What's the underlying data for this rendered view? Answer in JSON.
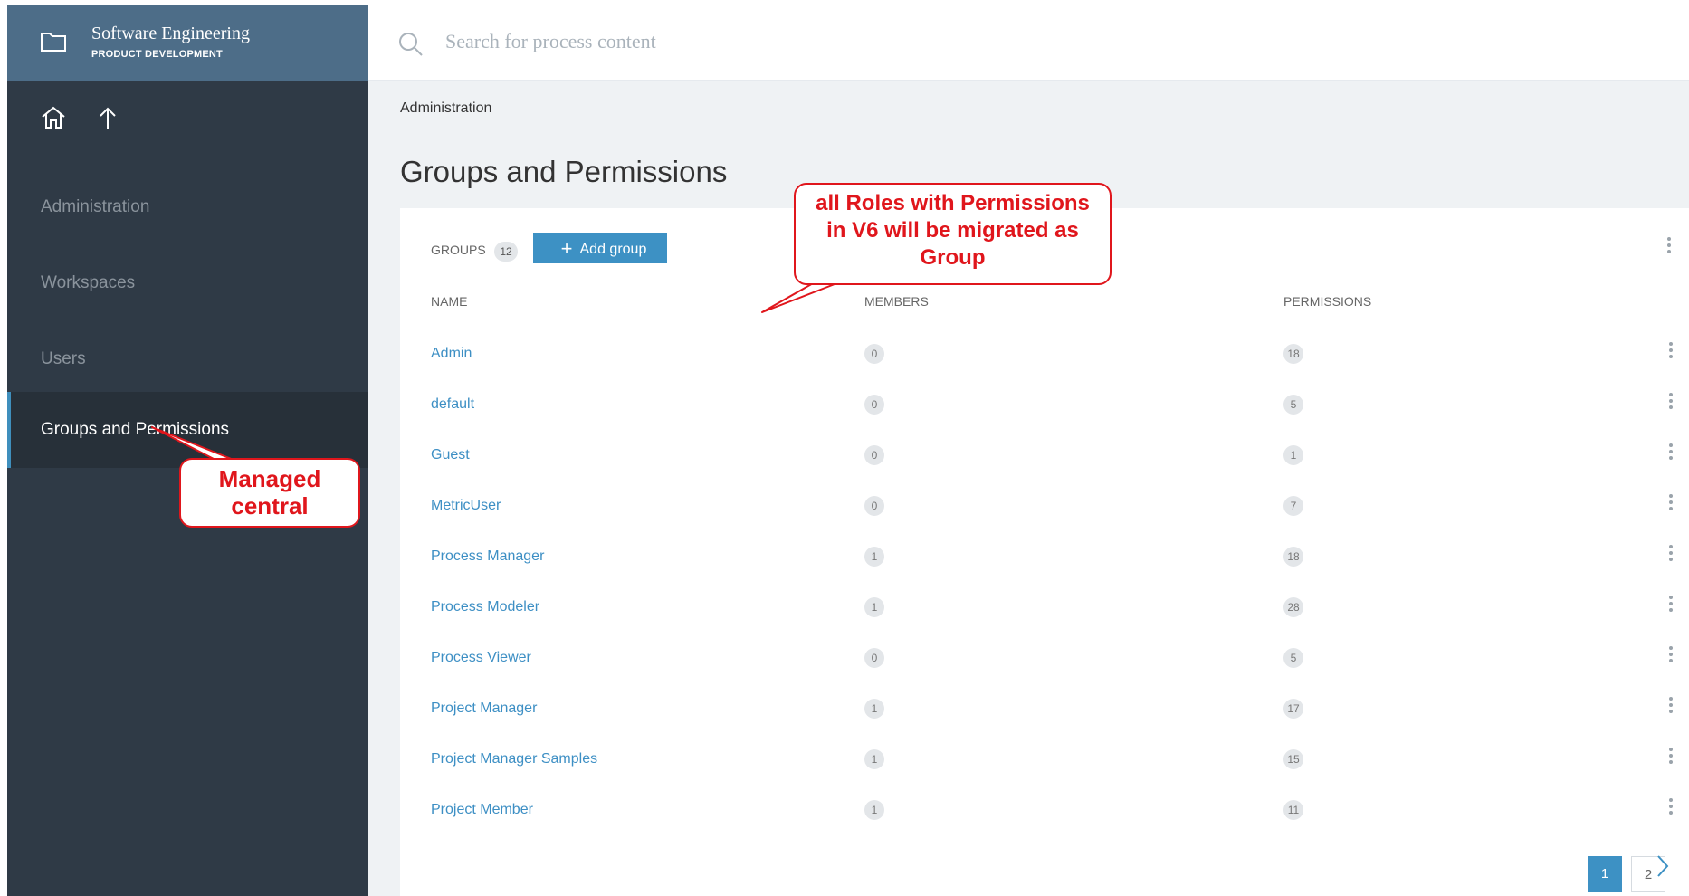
{
  "sidebar": {
    "brand_title": "Software Engineering",
    "brand_subtitle": "PRODUCT DEVELOPMENT",
    "items": [
      {
        "label": "Administration",
        "active": false
      },
      {
        "label": "Workspaces",
        "active": false
      },
      {
        "label": "Users",
        "active": false
      },
      {
        "label": "Groups and Permissions",
        "active": true
      }
    ]
  },
  "search": {
    "placeholder": "Search for process content"
  },
  "breadcrumb": "Administration",
  "page_title": "Groups and Permissions",
  "groups": {
    "label": "GROUPS",
    "count": "12",
    "add_label": "Add group",
    "columns": {
      "name": "NAME",
      "members": "MEMBERS",
      "permissions": "PERMISSIONS"
    },
    "rows": [
      {
        "name": "Admin",
        "members": "0",
        "permissions": "18"
      },
      {
        "name": "default",
        "members": "0",
        "permissions": "5"
      },
      {
        "name": "Guest",
        "members": "0",
        "permissions": "1"
      },
      {
        "name": "MetricUser",
        "members": "0",
        "permissions": "7"
      },
      {
        "name": "Process Manager",
        "members": "1",
        "permissions": "18"
      },
      {
        "name": "Process Modeler",
        "members": "1",
        "permissions": "28"
      },
      {
        "name": "Process Viewer",
        "members": "0",
        "permissions": "5"
      },
      {
        "name": "Project Manager",
        "members": "1",
        "permissions": "17"
      },
      {
        "name": "Project Manager Samples",
        "members": "1",
        "permissions": "15"
      },
      {
        "name": "Project Member",
        "members": "1",
        "permissions": "11"
      }
    ]
  },
  "pagination": {
    "pages": [
      "1",
      "2"
    ],
    "current": "1"
  },
  "annotations": {
    "callout_roles": {
      "line1": "all Roles with Permissions",
      "line2": "in V6 will be migrated as",
      "line3": "Group"
    },
    "callout_central": {
      "line1": "Managed",
      "line2": "central"
    }
  },
  "colors": {
    "sidebar_bg": "#2f3a46",
    "brand_bg": "#4d6d88",
    "accent": "#3d91c4",
    "link": "#3d8fc4",
    "callout": "#e0161c"
  }
}
